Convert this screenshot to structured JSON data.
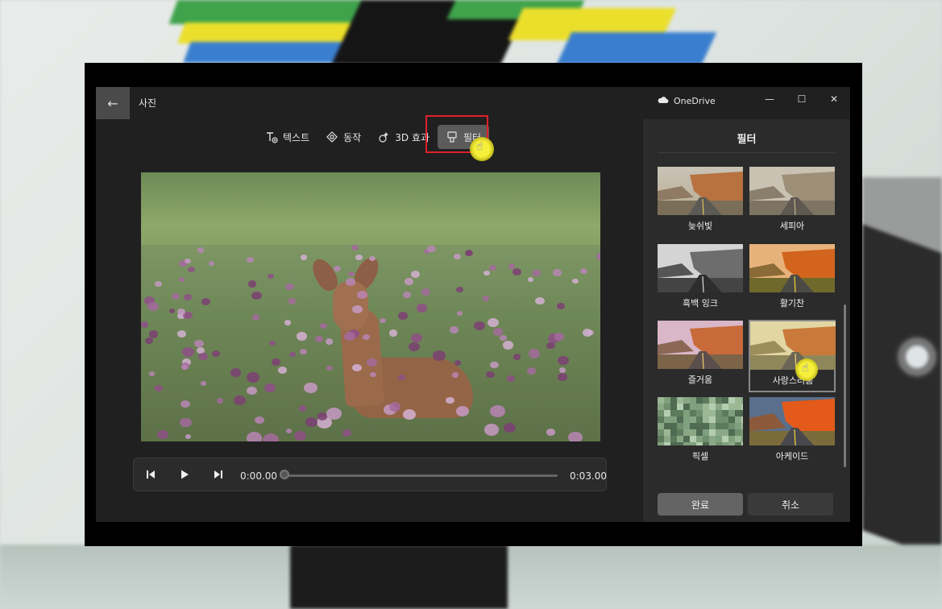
{
  "window": {
    "title": "사진",
    "storage": "OneDrive"
  },
  "toolbar": {
    "items": [
      {
        "label": "텍스트",
        "icon": "text-icon"
      },
      {
        "label": "동작",
        "icon": "motion-icon"
      },
      {
        "label": "3D 효과",
        "icon": "3d-effects-icon"
      },
      {
        "label": "필터",
        "icon": "filter-icon",
        "active": true
      }
    ]
  },
  "player": {
    "current_time": "0:00.00",
    "total_time": "0:03.00",
    "progress": 0
  },
  "panel": {
    "title": "필터",
    "filters": [
      {
        "label": "늦쉬빛"
      },
      {
        "label": "세피아"
      },
      {
        "label": "흑백 잉크"
      },
      {
        "label": "활기찬"
      },
      {
        "label": "즐거움"
      },
      {
        "label": "사랑스러움",
        "selected": true
      },
      {
        "label": "픽셀"
      },
      {
        "label": "아케이드"
      }
    ],
    "done_label": "완료",
    "cancel_label": "취소"
  },
  "colors": {
    "highlight": "#e0202a",
    "cursor": "#f6f03a"
  }
}
